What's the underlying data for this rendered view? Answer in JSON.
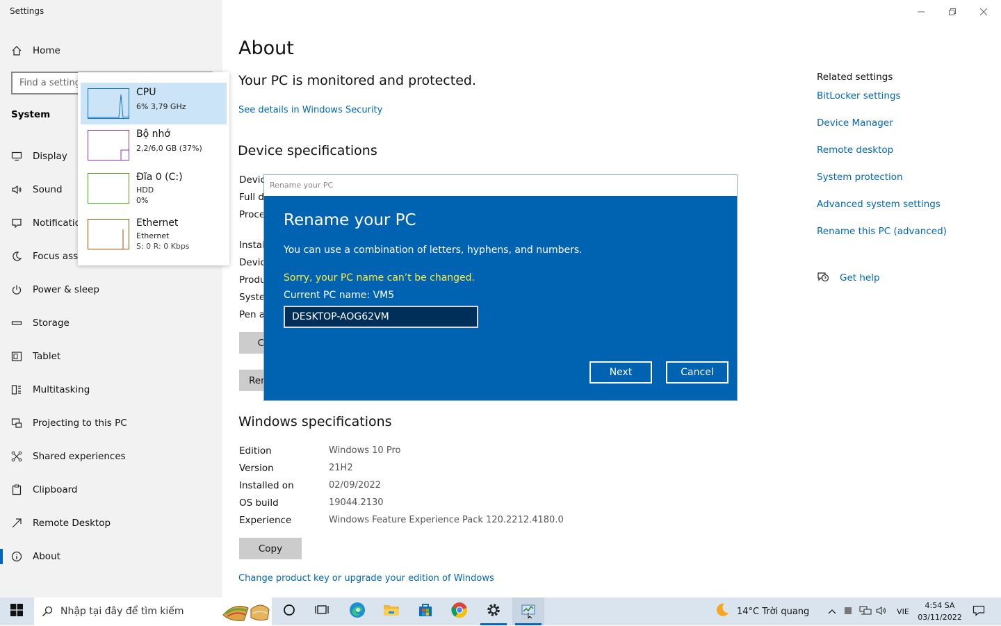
{
  "window": {
    "title": "Settings"
  },
  "sidebar": {
    "home_label": "Home",
    "search_placeholder": "Find a setting",
    "section_label": "System",
    "items": [
      {
        "label": "Display",
        "icon": "monitor-icon"
      },
      {
        "label": "Sound",
        "icon": "speaker-icon"
      },
      {
        "label": "Notifications & actions",
        "icon": "notification-icon"
      },
      {
        "label": "Focus assist",
        "icon": "moon-icon"
      },
      {
        "label": "Power & sleep",
        "icon": "power-icon"
      },
      {
        "label": "Storage",
        "icon": "storage-icon"
      },
      {
        "label": "Tablet",
        "icon": "tablet-icon"
      },
      {
        "label": "Multitasking",
        "icon": "multitasking-icon"
      },
      {
        "label": "Projecting to this PC",
        "icon": "projecting-icon"
      },
      {
        "label": "Shared experiences",
        "icon": "shared-icon"
      },
      {
        "label": "Clipboard",
        "icon": "clipboard-icon"
      },
      {
        "label": "Remote Desktop",
        "icon": "remote-desktop-icon"
      },
      {
        "label": "About",
        "icon": "info-icon",
        "selected": true
      }
    ]
  },
  "main": {
    "title": "About",
    "protected_text": "Your PC is monitored and protected.",
    "security_link": "See details in Windows Security",
    "device_spec_heading": "Device specifications",
    "device_rows": [
      "Devic",
      "Full d",
      "Proce",
      "Install",
      "Devic",
      "Produ",
      "Syster",
      "Pen ar"
    ],
    "copy_btn_partial": "C",
    "rename_btn_partial": "Ren",
    "windows_spec_heading": "Windows specifications",
    "windows_rows": [
      {
        "label": "Edition",
        "value": "Windows 10 Pro"
      },
      {
        "label": "Version",
        "value": "21H2"
      },
      {
        "label": "Installed on",
        "value": "02/09/2022"
      },
      {
        "label": "OS build",
        "value": "19044.2130"
      },
      {
        "label": "Experience",
        "value": "Windows Feature Experience Pack 120.2212.4180.0"
      }
    ],
    "copy_button": "Copy",
    "product_key_link": "Change product key or upgrade your edition of Windows"
  },
  "related": {
    "heading": "Related settings",
    "links": [
      "BitLocker settings",
      "Device Manager",
      "Remote desktop",
      "System protection",
      "Advanced system settings",
      "Rename this PC (advanced)"
    ],
    "help_label": "Get help"
  },
  "perf_popup": {
    "items": [
      {
        "name": "CPU",
        "line1": "6% 3,79 GHz",
        "color": "#1174c2",
        "selected": true
      },
      {
        "name": "Bộ nhớ",
        "line1": "2,2/6,0 GB (37%)",
        "color": "#8b2fc9"
      },
      {
        "name": "Đĩa 0 (C:)",
        "line1": "HDD",
        "line2": "0%",
        "color": "#4da60c"
      },
      {
        "name": "Ethernet",
        "line1": "Ethernet",
        "line2": "S: 0 R: 0 Kbps",
        "color": "#a74f01"
      }
    ]
  },
  "dialog": {
    "window_title": "Rename your PC",
    "title": "Rename your PC",
    "description": "You can use a combination of letters, hyphens, and numbers.",
    "error": "Sorry, your PC name can’t be changed.",
    "current_name": "Current PC name: VM5",
    "input_value": "DESKTOP-AOG62VM",
    "next_label": "Next",
    "cancel_label": "Cancel",
    "colors": {
      "background": "#0063b1",
      "error": "#ffeb3b"
    }
  },
  "taskbar": {
    "search_placeholder": "Nhập tại đây để tìm kiếm",
    "weather": "14°C  Trời quang",
    "lang": "VIE",
    "time": "4:54 SA",
    "date": "03/11/2022"
  }
}
